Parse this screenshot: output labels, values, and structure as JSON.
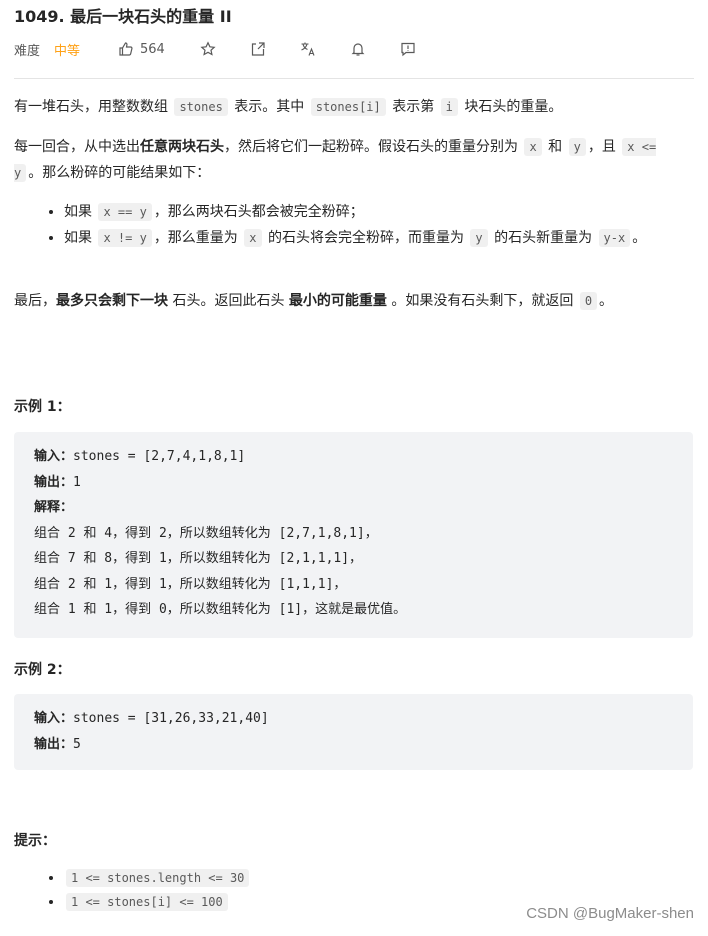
{
  "header": {
    "title": "1049. 最后一块石头的重量 II",
    "difficulty_label": "难度",
    "difficulty_value": "中等",
    "difficulty_color": "#ffa116",
    "like_count": "564",
    "actions": [
      "thumbs-up-icon",
      "star-icon",
      "share-icon",
      "translate-icon",
      "bell-icon",
      "feedback-icon"
    ]
  },
  "description": {
    "p1": {
      "t1": "有一堆石头，用整数数组",
      "c1": "stones",
      "t2": "表示。其中",
      "c2": "stones[i]",
      "t3": "表示第",
      "c3": "i",
      "t4": "块石头的重量。"
    },
    "p2": {
      "t1": "每一回合，从中选出",
      "b1": "任意两块石头",
      "t2": "，然后将它们一起粉碎。假设石头的重量分别为",
      "c1": "x",
      "t3": "和",
      "c2": "y",
      "t4": "，且",
      "c3": "x <= y",
      "t5": "。那么粉碎的可能结果如下："
    },
    "bullets": [
      {
        "t1": "如果",
        "c1": "x == y",
        "t2": "，那么两块石头都会被完全粉碎；"
      },
      {
        "t1": "如果",
        "c1": "x != y",
        "t2": "，那么重量为",
        "c2": "x",
        "t3": "的石头将会完全粉碎，而重量为",
        "c3": "y",
        "t4": "的石头新重量为",
        "c4": "y-x",
        "t5": "。"
      }
    ],
    "p3": {
      "t1": "最后，",
      "b1": "最多只会剩下一块",
      "t2": " 石头。返回此石头 ",
      "b2": "最小的可能重量",
      "t3": " 。如果没有石头剩下，就返回",
      "c1": "0",
      "t4": "。"
    }
  },
  "examples": [
    {
      "heading": "示例 1：",
      "input_label": "输入：",
      "input_value": "stones = [2,7,4,1,8,1]",
      "output_label": "输出：",
      "output_value": "1",
      "explain_label": "解释：",
      "explain_lines": [
        "组合 2 和 4，得到 2，所以数组转化为 [2,7,1,8,1]，",
        "组合 7 和 8，得到 1，所以数组转化为 [2,1,1,1]，",
        "组合 2 和 1，得到 1，所以数组转化为 [1,1,1]，",
        "组合 1 和 1，得到 0，所以数组转化为 [1]，这就是最优值。"
      ]
    },
    {
      "heading": "示例 2：",
      "input_label": "输入：",
      "input_value": "stones = [31,26,33,21,40]",
      "output_label": "输出：",
      "output_value": "5"
    }
  ],
  "constraints": {
    "heading": "提示：",
    "items": [
      "1 <= stones.length <= 30",
      "1 <= stones[i] <= 100"
    ]
  },
  "watermark": "CSDN @BugMaker-shen"
}
